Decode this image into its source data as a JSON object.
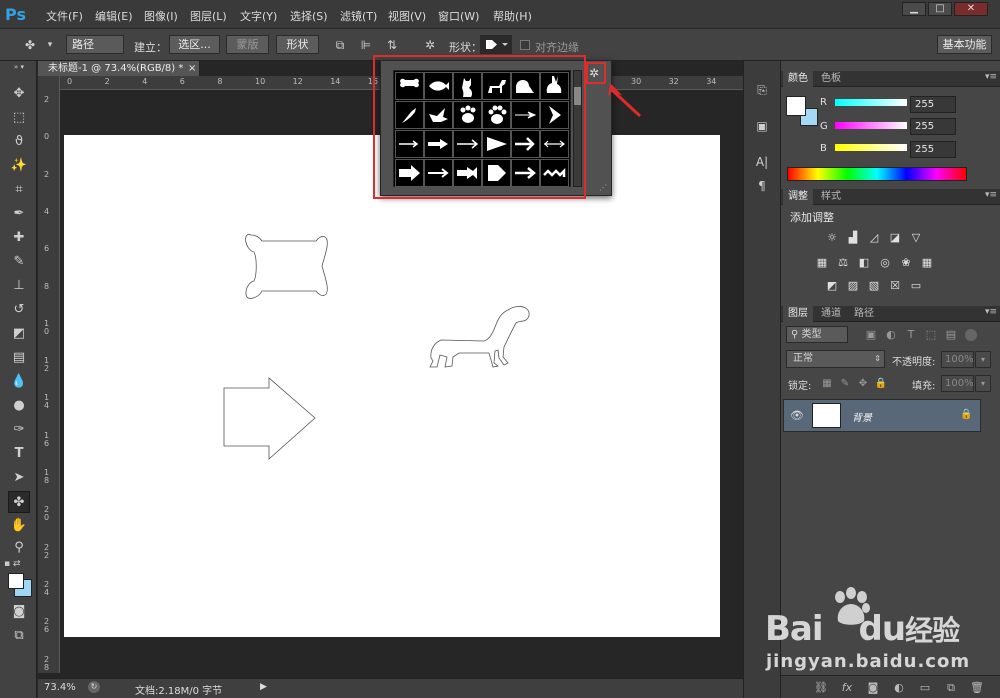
{
  "app": {
    "logo": "Ps"
  },
  "menu": [
    "文件(F)",
    "编辑(E)",
    "图像(I)",
    "图层(L)",
    "文字(Y)",
    "选择(S)",
    "滤镜(T)",
    "视图(V)",
    "窗口(W)",
    "帮助(H)"
  ],
  "window_controls": {
    "minimize": "▁",
    "maximize": "□",
    "close": "✕"
  },
  "options": {
    "mode": "路径",
    "make_label": "建立：",
    "selection_btn": "选区...",
    "mask_btn": "蒙版",
    "shape_btn": "形状",
    "shape_label": "形状：",
    "align_edges": "对齐边缘",
    "workspace": "基本功能"
  },
  "document": {
    "tab_title": "未标题-1 @ 73.4%(RGB/8) *",
    "close": "×",
    "hruler": [
      "0",
      "2",
      "4",
      "6",
      "8",
      "10",
      "12",
      "14",
      "16",
      "18",
      "20",
      "22",
      "24",
      "26",
      "28",
      "30",
      "32",
      "34"
    ],
    "vruler": [
      "2",
      "0",
      "2",
      "4",
      "6",
      "8",
      "1 0",
      "1 2",
      "1 4",
      "1 6",
      "1 8",
      "2 0",
      "2 2",
      "2 4",
      "2 6",
      "2 8"
    ]
  },
  "status": {
    "zoom": "73.4%",
    "doc": "文档:2.18M/0 字节"
  },
  "color_panel": {
    "tabs": [
      "颜色",
      "色板"
    ],
    "channels": [
      {
        "label": "R",
        "value": "255"
      },
      {
        "label": "G",
        "value": "255"
      },
      {
        "label": "B",
        "value": "255"
      }
    ]
  },
  "adjust_panel": {
    "tabs": [
      "调整",
      "样式"
    ],
    "title": "添加调整"
  },
  "layers_panel": {
    "tabs": [
      "图层",
      "通道",
      "路径"
    ],
    "filter": "类型",
    "blend": "正常",
    "opacity_label": "不透明度:",
    "opacity": "100%",
    "lock_label": "锁定:",
    "fill_label": "填充:",
    "fill": "100%",
    "layer_name": "背景"
  },
  "shape_picker": {
    "shapes": [
      "bone",
      "fish",
      "cat",
      "dog",
      "snail",
      "rabbit",
      "bird",
      "dove",
      "paw-print",
      "paw-print-2",
      "arrow-feather",
      "chevron",
      "arrow-thin",
      "arrow-double",
      "arrow-line",
      "arrow-triangle",
      "arrow-bold",
      "arrow-feather-2",
      "arrow-block",
      "arrow-dash",
      "arrow-tripple",
      "arrow-pentagon",
      "arrow-plain",
      "arrow-wave"
    ]
  },
  "watermark": {
    "brand": "Bai",
    "brand2": "du",
    "cn": "经验",
    "url": "jingyan.baidu.com"
  }
}
